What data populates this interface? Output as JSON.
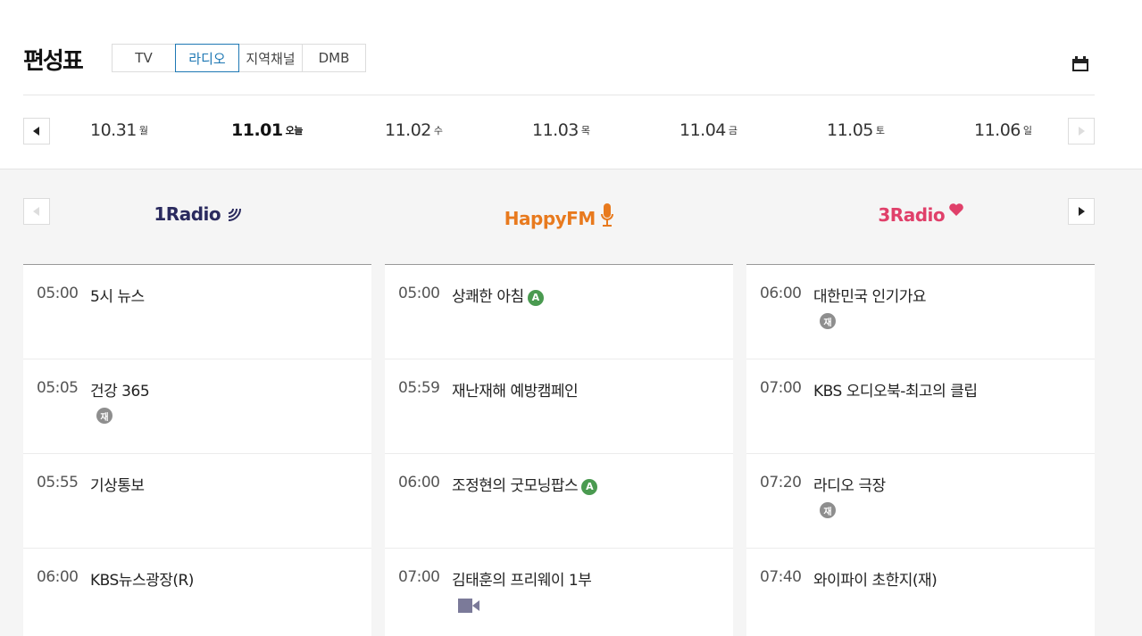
{
  "header": {
    "title": "편성표",
    "tabs": [
      {
        "label": "TV",
        "active": false
      },
      {
        "label": "라디오",
        "active": true
      },
      {
        "label": "지역채널",
        "active": false
      },
      {
        "label": "DMB",
        "active": false
      }
    ],
    "calendar_icon": "calendar-icon"
  },
  "dates": [
    {
      "date": "10.31",
      "dow": "월"
    },
    {
      "date": "11.01",
      "dow": "오늘",
      "today": true
    },
    {
      "date": "11.02",
      "dow": "수"
    },
    {
      "date": "11.03",
      "dow": "목"
    },
    {
      "date": "11.04",
      "dow": "금"
    },
    {
      "date": "11.05",
      "dow": "토"
    },
    {
      "date": "11.06",
      "dow": "일"
    }
  ],
  "channels": [
    {
      "name": "1Radio",
      "color": "#2a2a5e"
    },
    {
      "name": "HappyFM",
      "color": "#e87a1e"
    },
    {
      "name": "3Radio",
      "color": "#e0406a"
    }
  ],
  "schedule": {
    "col1": [
      {
        "time": "05:00",
        "title": "5시 뉴스"
      },
      {
        "time": "05:05",
        "title": "건강 365",
        "rerun": "재"
      },
      {
        "time": "05:55",
        "title": "기상통보"
      },
      {
        "time": "06:00",
        "title": "KBS뉴스광장(R)"
      }
    ],
    "col2": [
      {
        "time": "05:00",
        "title": "상쾌한 아침",
        "badge": "A"
      },
      {
        "time": "05:59",
        "title": "재난재해 예방캠페인"
      },
      {
        "time": "06:00",
        "title": "조정현의 굿모닝팝스",
        "badge": "A"
      },
      {
        "time": "07:00",
        "title": "김태훈의 프리웨이 1부",
        "icon": "video-icon"
      }
    ],
    "col3": [
      {
        "time": "06:00",
        "title": "대한민국 인기가요",
        "rerun": "재"
      },
      {
        "time": "07:00",
        "title": "KBS 오디오북-최고의 클립"
      },
      {
        "time": "07:20",
        "title": "라디오 극장",
        "rerun": "재"
      },
      {
        "time": "07:40",
        "title": "와이파이 초한지(재)"
      }
    ]
  },
  "colors": {
    "accent": "#1e78b4",
    "badge_a": "#4a9a50",
    "badge_rerun": "#8e8e8e",
    "video": "#7b7a99"
  }
}
